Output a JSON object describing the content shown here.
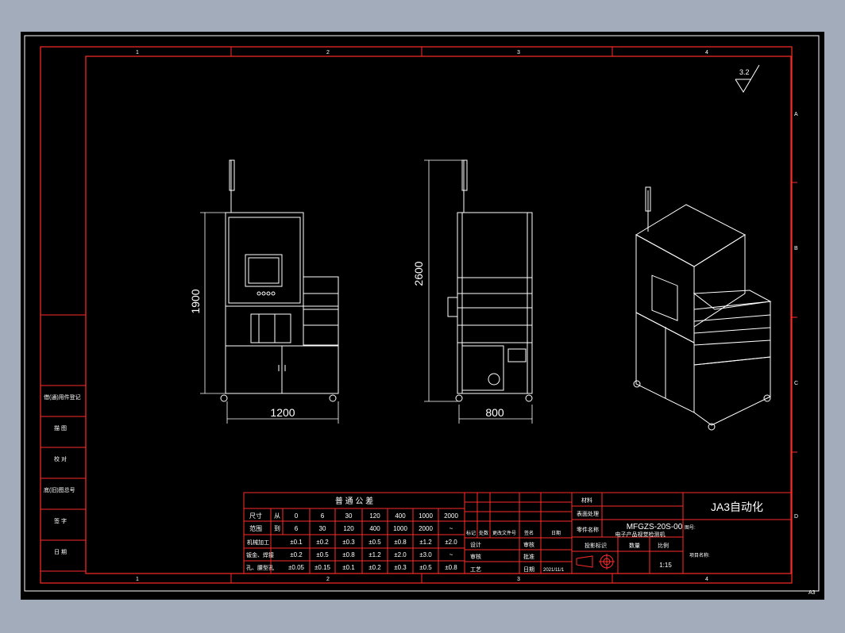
{
  "corner_label": "A3",
  "surface_roughness": "3.2",
  "zone_columns": [
    "1",
    "2",
    "3",
    "4"
  ],
  "zone_rows": [
    "A",
    "B",
    "C",
    "D"
  ],
  "dimensions": {
    "front_height": "1900",
    "front_width": "1200",
    "side_height": "2600",
    "side_width": "800"
  },
  "revision_block": [
    "借(通)用件登记",
    "描 图",
    "校 对",
    "底(旧)图总号",
    "签 字",
    "日 期"
  ],
  "tolerance_table": {
    "title": "普 通 公 差",
    "size_label": "尺寸",
    "range_label": "范围",
    "from_label": "从",
    "to_label": "到",
    "from_values": [
      "0",
      "6",
      "30",
      "120",
      "400",
      "1000",
      "2000"
    ],
    "to_values": [
      "6",
      "30",
      "120",
      "400",
      "1000",
      "2000",
      "~"
    ],
    "rows": [
      {
        "label": "机械加工",
        "values": [
          "±0.1",
          "±0.2",
          "±0.3",
          "±0.5",
          "±0.8",
          "±1.2",
          "±2.0"
        ]
      },
      {
        "label": "钣金、焊接",
        "values": [
          "±0.2",
          "±0.5",
          "±0.8",
          "±1.2",
          "±2.0",
          "±3.0",
          "~"
        ]
      },
      {
        "label": "孔、腰型孔",
        "values": [
          "±0.05",
          "±0.15",
          "±0.1",
          "±0.2",
          "±0.3",
          "±0.5",
          "±0.8"
        ]
      }
    ]
  },
  "change_labels": [
    "标记",
    "处数",
    "更改文件号",
    "签名",
    "日期"
  ],
  "approval_labels": [
    "设计",
    "审核",
    "工艺"
  ],
  "approval_labels_right": [
    "审核",
    "批准",
    "日期"
  ],
  "date_value": "2021/11/1",
  "title_block": {
    "company": "JA3自动化",
    "material_label": "材料",
    "surface_label": "表面处理",
    "part_name_label": "零件名称",
    "drawing_no": "MFGZS-20S-00",
    "drawing_no_label": "图号:",
    "part_name": "电子产品视觉检测机",
    "projection_label": "投影标识",
    "quantity_label": "数量",
    "scale_label": "比例",
    "scale_value": "1:15",
    "project_label": "项目名称:"
  }
}
